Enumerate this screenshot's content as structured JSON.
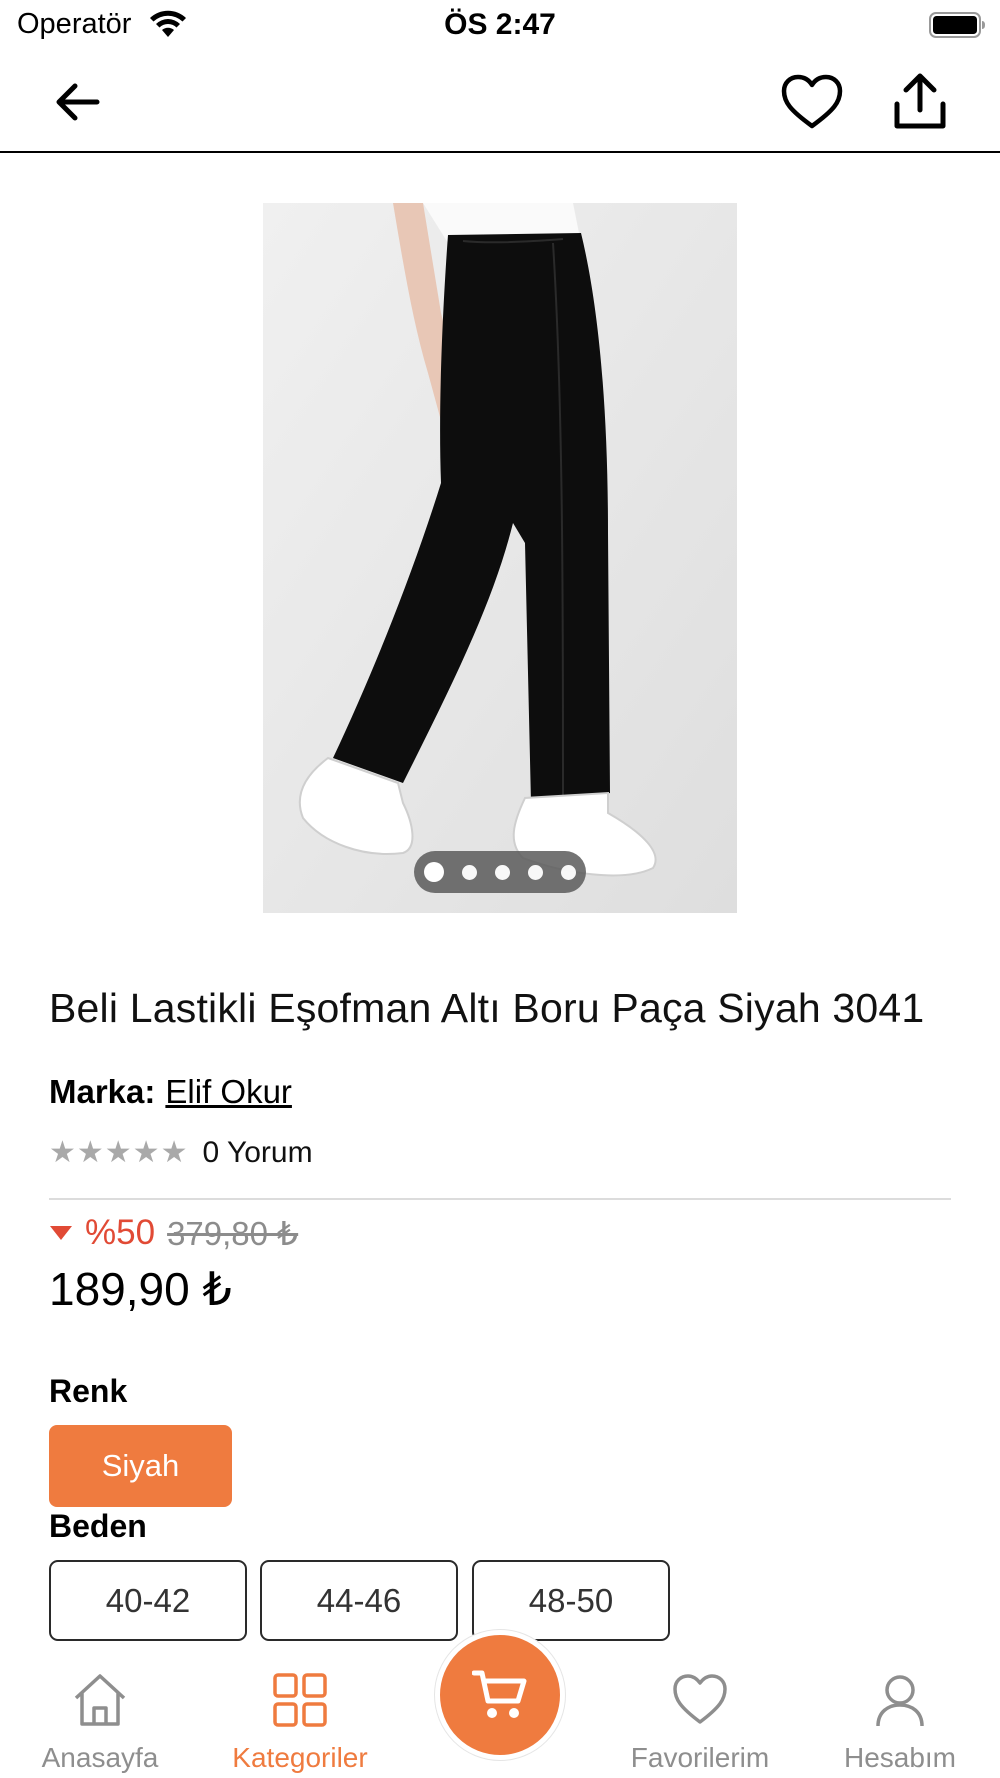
{
  "status_bar": {
    "carrier": "Operatör",
    "time": "ÖS 2:47"
  },
  "nav": {
    "back_icon": "arrow-left-icon",
    "favorite_icon": "heart-outline-icon",
    "share_icon": "share-upload-icon"
  },
  "gallery": {
    "image_count": 5,
    "active_index": 0
  },
  "product": {
    "title": "Beli Lastikli Eşofman Altı Boru Paça Siyah 3041",
    "brand_label": "Marka:",
    "brand_name": "Elif Okur",
    "stars": "★★★★★",
    "rating": 0,
    "review_count": "0 Yorum",
    "discount": "%50",
    "old_price": "379,80 ₺",
    "price": "189,90 ₺"
  },
  "options": {
    "color_label": "Renk",
    "colors": [
      "Siyah"
    ],
    "size_label": "Beden",
    "sizes": [
      "40-42",
      "44-46",
      "48-50"
    ]
  },
  "tab_bar": {
    "tabs": [
      {
        "label": "Anasayfa",
        "icon": "home-icon"
      },
      {
        "label": "Kategoriler",
        "icon": "grid-icon",
        "active": true
      },
      {
        "label": "Favorilerim",
        "icon": "heart-icon"
      },
      {
        "label": "Hesabım",
        "icon": "user-icon"
      }
    ],
    "cart_icon": "cart-icon"
  },
  "colors": {
    "accent": "#EF7B3F",
    "discount": "#E14A35",
    "inactive_tab": "#8E8E8E"
  }
}
